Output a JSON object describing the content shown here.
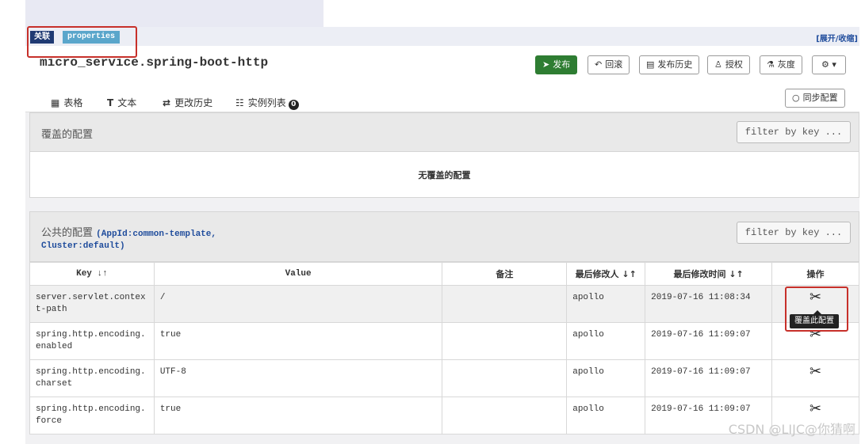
{
  "tags": {
    "relation": "关联",
    "format": "properties",
    "expand": "[展开/收缩]"
  },
  "namespace": {
    "title": "micro_service.spring-boot-http"
  },
  "actions": {
    "publish": "发布",
    "rollback": "回滚",
    "history": "发布历史",
    "authorize": "授权",
    "gray": "灰度"
  },
  "tabs": [
    {
      "label": "表格",
      "icon": "table-icon"
    },
    {
      "label": "文本",
      "icon": "text-icon"
    },
    {
      "label": "更改历史",
      "icon": "swap-icon"
    },
    {
      "label": "实例列表",
      "icon": "list-icon",
      "badge": "0"
    }
  ],
  "sync_button": "同步配置",
  "override_section": {
    "title": "覆盖的配置",
    "filter_placeholder": "filter by key ...",
    "empty_text": "无覆盖的配置"
  },
  "public_section": {
    "title": "公共的配置",
    "app_id": "(AppId:common-template,",
    "cluster": "Cluster:default)",
    "filter_placeholder": "filter by key ..."
  },
  "table": {
    "headers": {
      "key": "Key",
      "value": "Value",
      "comment": "备注",
      "modifier": "最后修改人",
      "time": "最后修改时间",
      "ops": "操作"
    },
    "rows": [
      {
        "key": "server.servlet.context-path",
        "value": "/",
        "comment": "",
        "user": "apollo",
        "time": "2019-07-16 11:08:34"
      },
      {
        "key": "spring.http.encoding.enabled",
        "value": "true",
        "comment": "",
        "user": "apollo",
        "time": "2019-07-16 11:09:07"
      },
      {
        "key": "spring.http.encoding.charset",
        "value": "UTF-8",
        "comment": "",
        "user": "apollo",
        "time": "2019-07-16 11:09:07"
      },
      {
        "key": "spring.http.encoding.force",
        "value": "true",
        "comment": "",
        "user": "apollo",
        "time": "2019-07-16 11:09:07"
      }
    ]
  },
  "tooltip": "覆盖此配置",
  "watermark": "CSDN @LIJC@你猜啊",
  "colors": {
    "publish_green": "#2e7d32",
    "highlight_red": "#c7302a",
    "tag_navy": "#1f3a73",
    "tag_blue": "#5aa6cb"
  }
}
